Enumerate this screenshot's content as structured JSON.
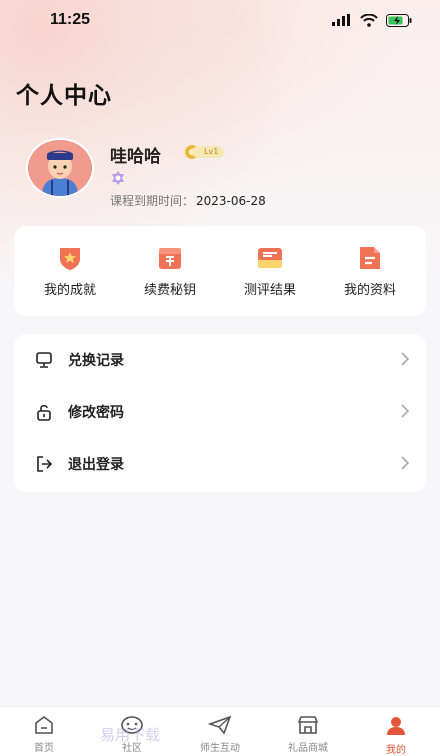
{
  "status_bar": {
    "time": "11:25"
  },
  "page": {
    "title": "个人中心"
  },
  "profile": {
    "username": "哇哈哈",
    "level": "Lv1",
    "expire_label": "课程到期时间：",
    "expire_date": "2023-06-28"
  },
  "quick_actions": [
    {
      "label": "我的成就",
      "icon": "achievement-icon"
    },
    {
      "label": "续费秘钥",
      "icon": "renew-key-icon"
    },
    {
      "label": "测评结果",
      "icon": "assessment-icon"
    },
    {
      "label": "我的资料",
      "icon": "profile-docs-icon"
    }
  ],
  "menu": [
    {
      "label": "兑换记录",
      "icon": "monitor-icon"
    },
    {
      "label": "修改密码",
      "icon": "unlock-icon"
    },
    {
      "label": "退出登录",
      "icon": "logout-icon"
    }
  ],
  "tabbar": [
    {
      "label": "首页",
      "icon": "home-icon",
      "active": false
    },
    {
      "label": "社区",
      "icon": "community-icon",
      "active": false
    },
    {
      "label": "师生互动",
      "icon": "paper-plane-icon",
      "active": false
    },
    {
      "label": "礼品商城",
      "icon": "store-icon",
      "active": false
    },
    {
      "label": "我的",
      "icon": "user-icon",
      "active": true
    }
  ],
  "colors": {
    "accent": "#e2553b",
    "background": "#f7f7f9"
  },
  "watermark": "易用下载"
}
